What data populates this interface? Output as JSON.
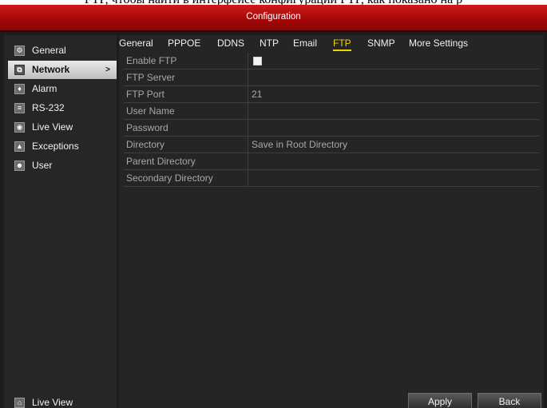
{
  "document": {
    "caption": "FTP, чтобы найти в интерфейсе конфигурации FTP, как показано на р"
  },
  "window": {
    "title": "Configuration"
  },
  "sidebar": {
    "items": [
      {
        "label": "General",
        "icon": "gear-icon",
        "glyph": "⚙"
      },
      {
        "label": "Network",
        "icon": "network-icon",
        "glyph": "⧉",
        "active": true
      },
      {
        "label": "Alarm",
        "icon": "alarm-icon",
        "glyph": "♦"
      },
      {
        "label": "RS-232",
        "icon": "serial-port-icon",
        "glyph": "≡"
      },
      {
        "label": "Live View",
        "icon": "eye-icon",
        "glyph": "◉"
      },
      {
        "label": "Exceptions",
        "icon": "warning-icon",
        "glyph": "▲"
      },
      {
        "label": "User",
        "icon": "user-icon",
        "glyph": "☻"
      }
    ],
    "active_arrow": ">",
    "bottom_live_view": {
      "label": "Live View",
      "icon": "home-icon",
      "glyph": "⌂"
    }
  },
  "tabs": [
    {
      "label": "General"
    },
    {
      "label": "PPPOE"
    },
    {
      "label": "DDNS"
    },
    {
      "label": "NTP"
    },
    {
      "label": "Email"
    },
    {
      "label": "FTP",
      "active": true
    },
    {
      "label": "SNMP"
    },
    {
      "label": "More Settings"
    }
  ],
  "form": {
    "enable_ftp": {
      "label": "Enable FTP",
      "checked": false
    },
    "ftp_server": {
      "label": "FTP Server",
      "value": ""
    },
    "ftp_port": {
      "label": "FTP Port",
      "value": "21"
    },
    "user_name": {
      "label": "User Name",
      "value": ""
    },
    "password": {
      "label": "Password",
      "value": ""
    },
    "directory": {
      "label": "Directory",
      "value": "Save in Root Directory"
    },
    "parent_directory": {
      "label": "Parent Directory",
      "value": ""
    },
    "secondary_directory": {
      "label": "Secondary Directory",
      "value": ""
    }
  },
  "buttons": {
    "apply": "Apply",
    "back": "Back"
  },
  "colors": {
    "title_red": "#c01010",
    "active_tab": "#f0d200",
    "background": "#252525"
  }
}
